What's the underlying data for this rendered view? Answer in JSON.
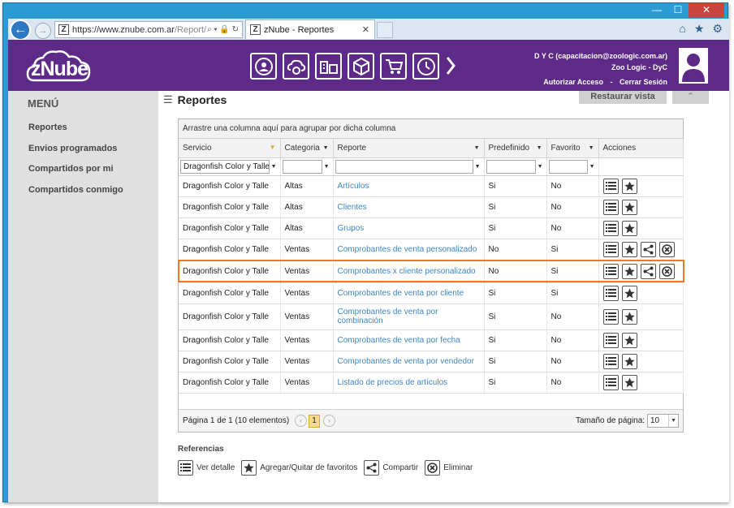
{
  "browser": {
    "url_main": "https://www.znube.com.ar",
    "url_rest": "/Report/",
    "addr_icons": "⌕ ▾ 🔒 ↻",
    "tab_title": "zNube - Reportes",
    "tab_close": "✕",
    "minimize": "—",
    "maximize": "☐",
    "close": "✕"
  },
  "header": {
    "logo": "zNube",
    "user_line1": "D Y C (capacitacion@zoologic.com.ar)",
    "user_line2": "Zoo Logic - DyC",
    "authorize": "Autorizar Acceso",
    "separator": "-",
    "logout": "Cerrar Sesión"
  },
  "sidebar": {
    "title": "MENÚ",
    "items": [
      {
        "label": "Reportes"
      },
      {
        "label": "Envios programados"
      },
      {
        "label": "Compartidos por mi"
      },
      {
        "label": "Compartidos conmigo"
      }
    ]
  },
  "main": {
    "title": "Reportes",
    "restore_label": "Restaurar vista",
    "collapse_label": "⌃"
  },
  "grid": {
    "group_panel_text": "Arrastre una columna aquí para agrupar por dicha columna",
    "columns": [
      "Servicio",
      "Categoria",
      "Reporte",
      "Predefinido",
      "Favorito",
      "Acciones"
    ],
    "filter_servicio": "Dragonfish Color y Talle",
    "rows": [
      {
        "servicio": "Dragonfish Color y Talle",
        "categoria": "Altas",
        "reporte": "Artículos",
        "predefinido": "Si",
        "favorito": "No"
      },
      {
        "servicio": "Dragonfish Color y Talle",
        "categoria": "Altas",
        "reporte": "Clientes",
        "predefinido": "Si",
        "favorito": "No"
      },
      {
        "servicio": "Dragonfish Color y Talle",
        "categoria": "Altas",
        "reporte": "Grupos",
        "predefinido": "Si",
        "favorito": "No"
      },
      {
        "servicio": "Dragonfish Color y Talle",
        "categoria": "Ventas",
        "reporte": "Comprobantes de venta personalizado",
        "predefinido": "No",
        "favorito": "Si"
      },
      {
        "servicio": "Dragonfish Color y Talle",
        "categoria": "Ventas",
        "reporte": "Comprobantes x cliente personalizado",
        "predefinido": "No",
        "favorito": "Si"
      },
      {
        "servicio": "Dragonfish Color y Talle",
        "categoria": "Ventas",
        "reporte": "Comprobantes de venta por cliente",
        "predefinido": "Si",
        "favorito": "Si"
      },
      {
        "servicio": "Dragonfish Color y Talle",
        "categoria": "Ventas",
        "reporte": "Comprobantes de venta por combinación",
        "predefinido": "Si",
        "favorito": "No"
      },
      {
        "servicio": "Dragonfish Color y Talle",
        "categoria": "Ventas",
        "reporte": "Comprobantes de venta por fecha",
        "predefinido": "Si",
        "favorito": "No"
      },
      {
        "servicio": "Dragonfish Color y Talle",
        "categoria": "Ventas",
        "reporte": "Comprobantes de venta por vendedor",
        "predefinido": "Si",
        "favorito": "No"
      },
      {
        "servicio": "Dragonfish Color y Talle",
        "categoria": "Ventas",
        "reporte": "Listado de precios de artículos",
        "predefinido": "Si",
        "favorito": "No"
      }
    ],
    "pager_text": "Página 1 de 1 (10 elementos)",
    "current_page": "1",
    "page_size_label": "Tamaño de página:",
    "page_size": "10"
  },
  "legend": {
    "title": "Referencias",
    "items": [
      {
        "label": "Ver detalle",
        "icon": "list-icon"
      },
      {
        "label": "Agregar/Quitar de favoritos",
        "icon": "star-icon"
      },
      {
        "label": "Compartir",
        "icon": "share-icon"
      },
      {
        "label": "Eliminar",
        "icon": "delete-icon"
      }
    ]
  },
  "colors": {
    "header_purple": "#5d2b87",
    "link_blue": "#3d86c6",
    "highlight_orange": "#f07a21",
    "window_blue": "#2b9bd4"
  }
}
